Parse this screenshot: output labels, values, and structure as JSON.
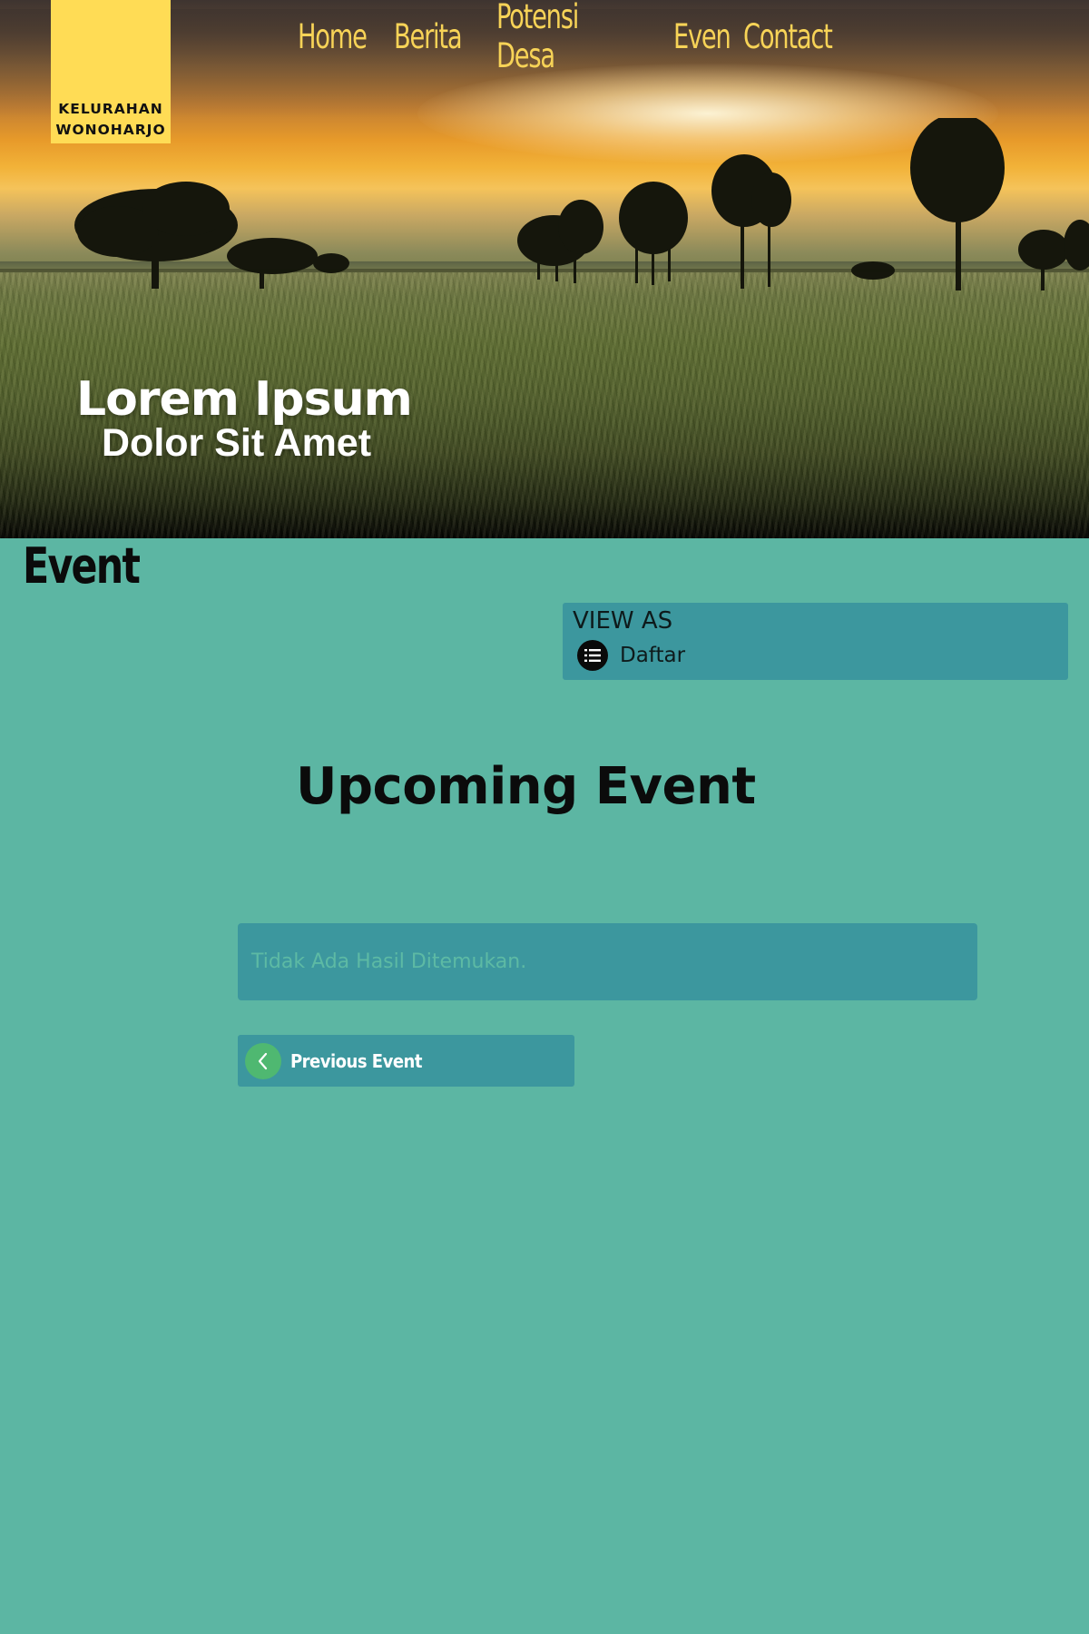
{
  "logo": {
    "line1": "KELURAHAN",
    "line2": "WONOHARJO"
  },
  "nav": {
    "items": [
      {
        "label": "Home"
      },
      {
        "label": "Berita"
      },
      {
        "label": "Potensi Desa"
      },
      {
        "label": "Even"
      },
      {
        "label": "Contact"
      }
    ]
  },
  "hero": {
    "title": "Lorem Ipsum",
    "subtitle": "Dolor Sit Amet"
  },
  "page": {
    "section_title": "Event"
  },
  "view_as": {
    "label": "VIEW AS",
    "option": "Daftar",
    "option_icon": "list-icon"
  },
  "events": {
    "heading": "Upcoming Event",
    "empty_message": "Tidak Ada Hasil Ditemukan.",
    "previous_label": "Previous Event",
    "previous_icon": "chevron-left-icon"
  },
  "colors": {
    "page_background": "#5cb6a3",
    "panel": "#3c979e",
    "logo_background": "#ffdc55",
    "nav_text": "#f7d357",
    "prev_button_circle": "#4fb871"
  }
}
